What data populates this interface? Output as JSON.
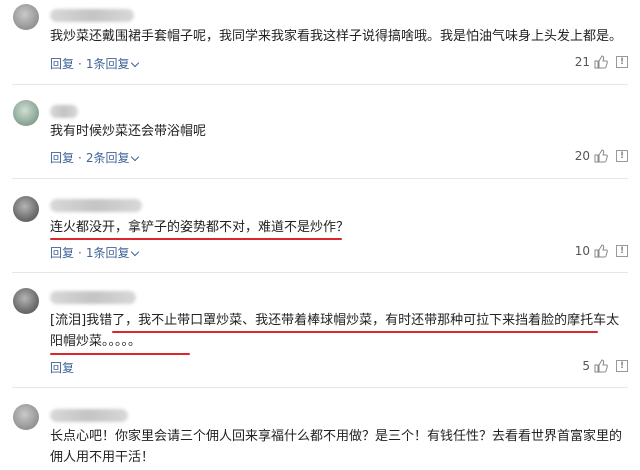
{
  "comments": [
    {
      "user_prefix": "",
      "text_lines": [
        "我炒菜还戴围裙手套帽子呢，我同学来我家看我这样子说得搞啥哦。我是怕油气味身上头发上都是。"
      ],
      "reply_label": "回复",
      "replies_label": "1条回复",
      "likes": "21"
    },
    {
      "user_prefix": "",
      "text_lines": [
        "我有时候炒菜还会带浴帽呢"
      ],
      "reply_label": "回复",
      "replies_label": "2条回复",
      "likes": "20"
    },
    {
      "user_prefix": "",
      "text_lines": [
        "连火都没开，拿铲子的姿势都不对，难道不是炒作？"
      ],
      "reply_label": "回复",
      "replies_label": "1条回复",
      "likes": "10"
    },
    {
      "user_prefix": "",
      "text_lines": [
        "[流泪]我错了，我不止带口罩炒菜、我还带着棒球帽炒菜，有时还带那种可拉下来挡着脸的摩托车太",
        "阳帽炒菜。。。。。"
      ],
      "reply_label": "回复",
      "replies_label": "",
      "likes": "5"
    },
    {
      "user_prefix": "",
      "text_lines": [
        "长点心吧！你家里会请三个佣人回来享福什么都不用做？是三个！有钱任性？去看看世界首富家里的",
        "佣人用不用干活！"
      ],
      "reply_label": "",
      "replies_label": "",
      "likes": ""
    }
  ],
  "icons": {
    "like": "thumbs-up-icon",
    "report": "report-icon",
    "expand": "chevron-down-icon"
  },
  "colors": {
    "link": "#406599",
    "highlight_underline": "#d9272b"
  }
}
